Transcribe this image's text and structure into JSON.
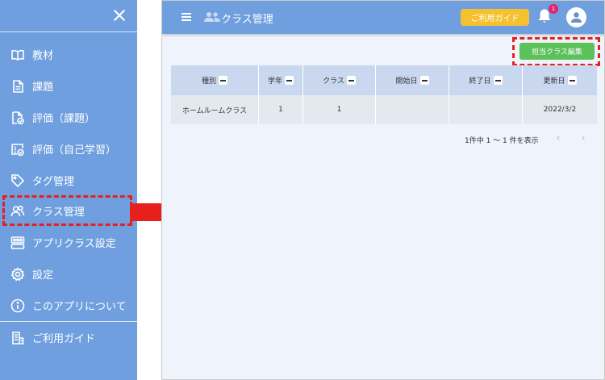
{
  "sidebar": {
    "items": [
      {
        "label": "教材",
        "icon": "book-icon"
      },
      {
        "label": "課題",
        "icon": "document-icon"
      },
      {
        "label": "評価（課題）",
        "icon": "document-check-icon"
      },
      {
        "label": "評価（自己学習）",
        "icon": "report-check-icon"
      },
      {
        "label": "タグ管理",
        "icon": "tag-icon"
      },
      {
        "label": "クラス管理",
        "icon": "users-icon"
      },
      {
        "label": "アプリクラス設定",
        "icon": "group-settings-icon"
      },
      {
        "label": "設定",
        "icon": "gear-icon"
      },
      {
        "label": "このアプリについて",
        "icon": "info-icon"
      },
      {
        "label": "ご利用ガイド",
        "icon": "guide-icon"
      }
    ]
  },
  "header": {
    "title": "クラス管理",
    "guide_label": "ご利用ガイド",
    "notification_count": "1"
  },
  "toolbar": {
    "edit_label": "担当クラス編集"
  },
  "table": {
    "columns": [
      "種別",
      "学年",
      "クラス",
      "開始日",
      "終了日",
      "更新日"
    ],
    "rows": [
      [
        "ホームルームクラス",
        "1",
        "1",
        "",
        "",
        "2022/3/2"
      ]
    ]
  },
  "pagination": {
    "summary": "1件中 1 〜 1 件を表示",
    "prev": "‹",
    "next": "›"
  },
  "colors": {
    "primary": "#6f9fde",
    "accent_yellow": "#f6c12f",
    "accent_green": "#5cc15b",
    "highlight_red": "#e8201d",
    "badge": "#e0256c"
  }
}
